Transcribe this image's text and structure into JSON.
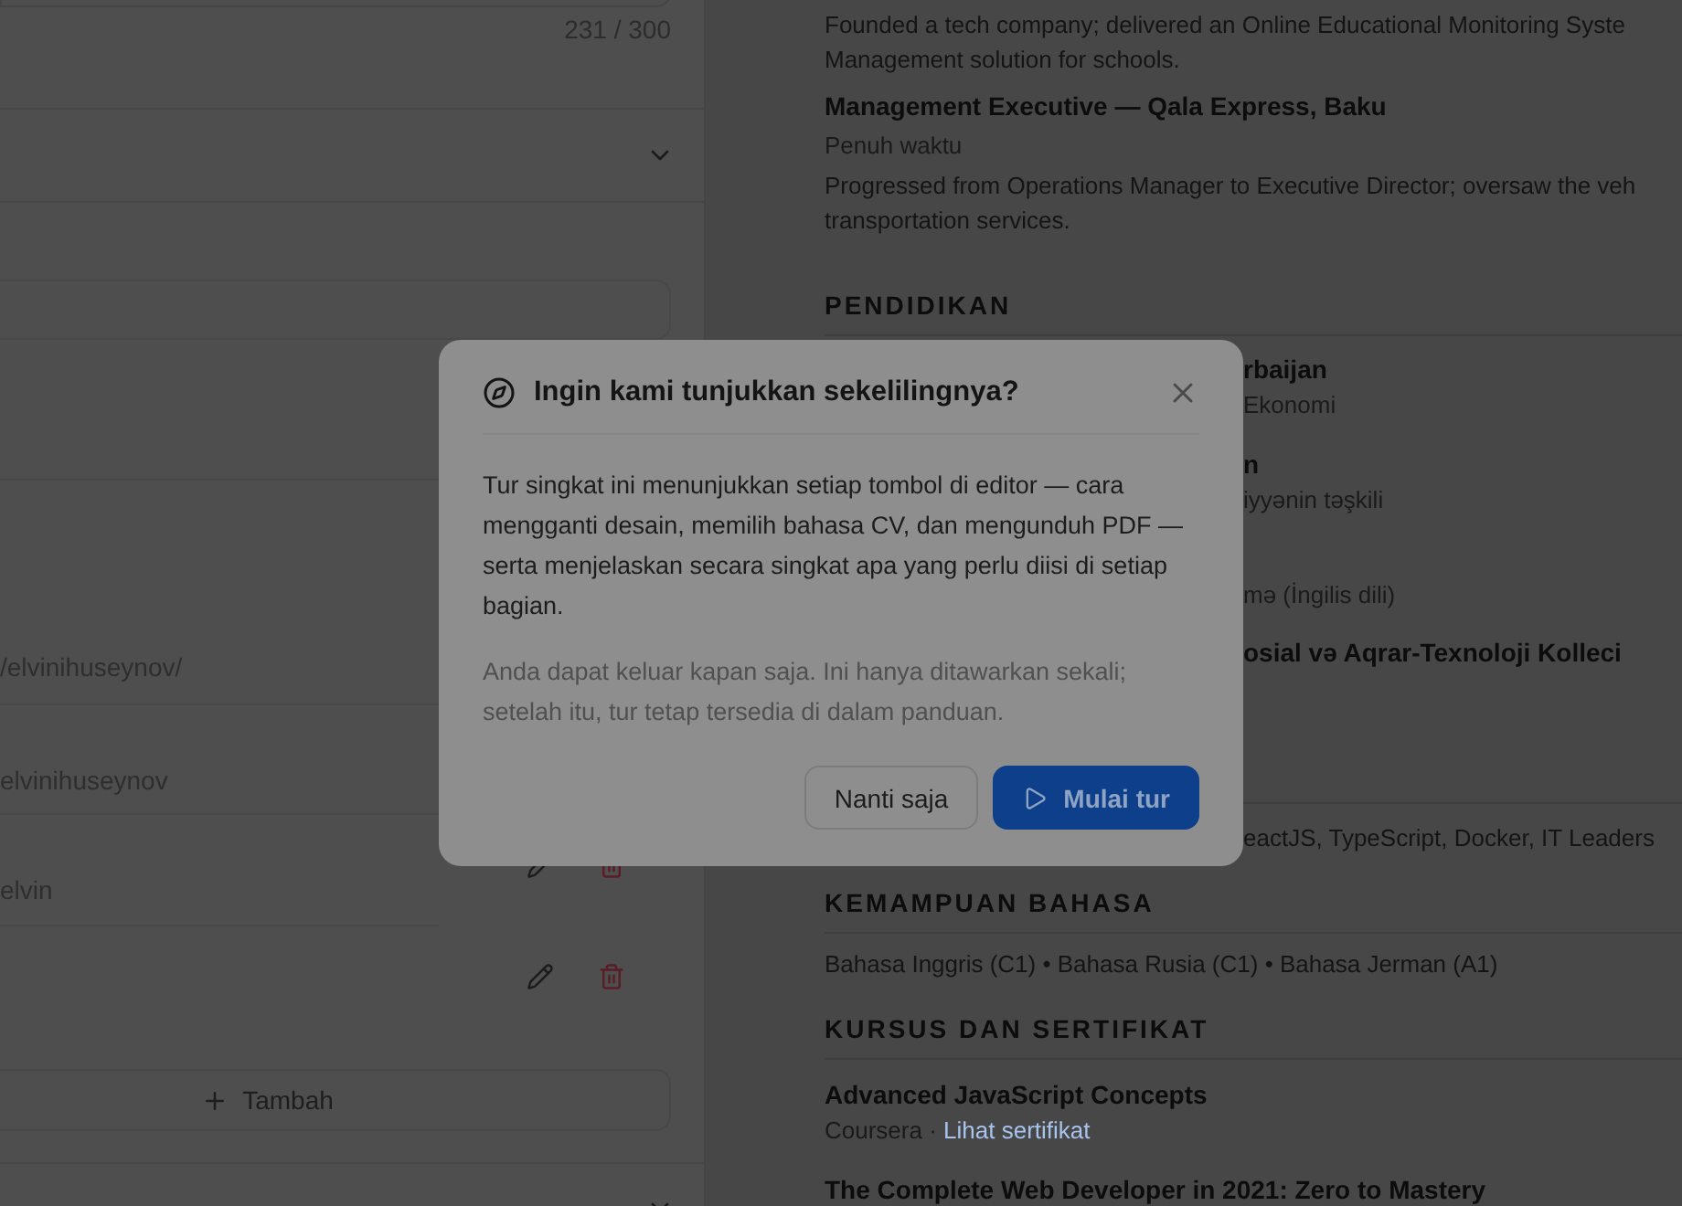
{
  "editor_panel": {
    "char_counter": "231 / 300",
    "link_fields": [
      {
        "value": "/elvinihuseynov/"
      },
      {
        "value": "elvinihuseynov"
      }
    ],
    "entries": [
      {
        "kind": "named",
        "name": "elvin"
      },
      {
        "kind": "blank"
      }
    ],
    "add_button": "Tambah"
  },
  "resume": {
    "intro_lines": [
      "Founded a tech company; delivered an Online Educational Monitoring Syste",
      "Management solution for schools."
    ],
    "job": {
      "title": "Management Executive — Qala Express, Baku",
      "type": "Penuh waktu",
      "description": [
        "Progressed from Operations Manager to Executive Director; oversaw the veh",
        "transportation services."
      ]
    },
    "education": {
      "heading": "PENDIDIKAN",
      "items": [
        {
          "title": "rbaijan",
          "subtitle": "Ekonomi"
        },
        {
          "title": "n",
          "subtitle": "iyyənin təşkili"
        },
        {
          "subtitle": "mə (İngilis dili)"
        },
        {
          "title": "osial və Aqrar-Texnoloji Kolleci"
        }
      ]
    },
    "skills_line": "eactJS, TypeScript, Docker, IT Leaders",
    "languages": {
      "heading": "KEMAMPUAN BAHASA",
      "text": "Bahasa Inggris (C1) • Bahasa Rusia (C1) • Bahasa Jerman (A1)"
    },
    "courses": {
      "heading": "KURSUS DAN SERTIFIKAT",
      "items": [
        {
          "title": "Advanced JavaScript Concepts",
          "provider": "Coursera · ",
          "link": "Lihat sertifikat"
        },
        {
          "title": "The Complete Web Developer in 2021: Zero to Mastery"
        }
      ]
    }
  },
  "dialog": {
    "title": "Ingin kami tunjukkan sekelilingnya?",
    "body": "Tur singkat ini menunjukkan setiap tombol di editor — cara mengganti desain, memilih bahasa CV, dan mengunduh PDF — serta menjelaskan secara singkat apa yang perlu diisi di setiap bagian.",
    "note": "Anda dapat keluar kapan saja. Ini hanya ditawarkan sekali; setelah itu, tur tetap tersedia di dalam panduan.",
    "secondary_button": "Nanti saja",
    "primary_button": "Mulai tur"
  }
}
